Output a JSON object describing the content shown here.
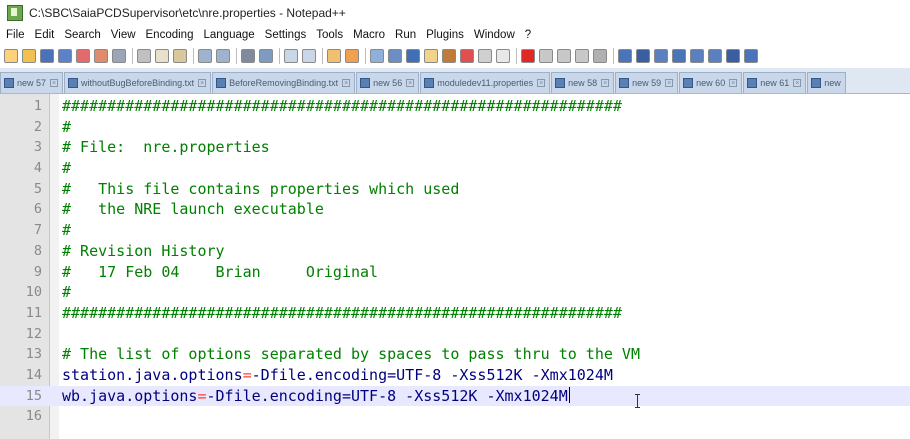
{
  "window": {
    "title": "C:\\SBC\\SaiaPCDSupervisor\\etc\\nre.properties - Notepad++"
  },
  "menu": [
    "File",
    "Edit",
    "Search",
    "View",
    "Encoding",
    "Language",
    "Settings",
    "Tools",
    "Macro",
    "Run",
    "Plugins",
    "Window",
    "?"
  ],
  "tabs": [
    {
      "label": "new 57"
    },
    {
      "label": "withoutBugBeforeBinding.txt"
    },
    {
      "label": "BeforeRemovingBinding.txt"
    },
    {
      "label": "new 56"
    },
    {
      "label": "moduledev11.properties"
    },
    {
      "label": "new 58"
    },
    {
      "label": "new 59"
    },
    {
      "label": "new 60"
    },
    {
      "label": "new 61"
    },
    {
      "label": "new"
    }
  ],
  "editor": {
    "lines": [
      {
        "n": "1",
        "type": "comment",
        "text": "##############################################################"
      },
      {
        "n": "2",
        "type": "comment",
        "text": "#"
      },
      {
        "n": "3",
        "type": "comment",
        "text": "# File:  nre.properties"
      },
      {
        "n": "4",
        "type": "comment",
        "text": "#"
      },
      {
        "n": "5",
        "type": "comment",
        "text": "#   This file contains properties which used"
      },
      {
        "n": "6",
        "type": "comment",
        "text": "#   the NRE launch executable"
      },
      {
        "n": "7",
        "type": "comment",
        "text": "#"
      },
      {
        "n": "8",
        "type": "comment",
        "text": "# Revision History"
      },
      {
        "n": "9",
        "type": "comment",
        "text": "#   17 Feb 04    Brian     Original"
      },
      {
        "n": "10",
        "type": "comment",
        "text": "#"
      },
      {
        "n": "11",
        "type": "comment",
        "text": "##############################################################"
      },
      {
        "n": "12",
        "type": "empty",
        "text": ""
      },
      {
        "n": "13",
        "type": "comment",
        "text": "# The list of options separated by spaces to pass thru to the VM"
      },
      {
        "n": "14",
        "type": "prop",
        "key": "station.java.options",
        "op": "=",
        "value": "-Dfile.encoding=UTF-8 -Xss512K -Xmx1024M"
      },
      {
        "n": "15",
        "type": "prop",
        "key": "wb.java.options",
        "op": "=",
        "value": "-Dfile.encoding=UTF-8 -Xss512K -Xmx1024M",
        "current": true
      },
      {
        "n": "16",
        "type": "empty",
        "text": ""
      }
    ]
  }
}
